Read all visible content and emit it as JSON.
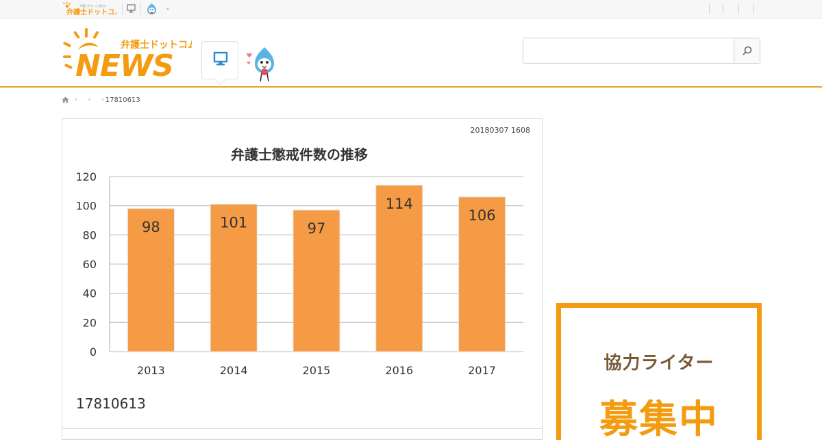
{
  "topbar": {
    "mini_logo_tagline": "弁護士をもっと身近に",
    "mini_logo_text": "弁護士ドットコム",
    "separator_text": "-"
  },
  "header": {
    "logo_top_text": "弁護士ドットコム",
    "logo_main_text": "NEWS",
    "search": {
      "placeholder": "",
      "value": ""
    }
  },
  "breadcrumb": {
    "current": "17810613"
  },
  "article": {
    "date": "20180307 1608",
    "caption": "17810613"
  },
  "chart_data": {
    "type": "bar",
    "title": "弁護士懲戒件数の推移",
    "categories": [
      "2013",
      "2014",
      "2015",
      "2016",
      "2017"
    ],
    "values": [
      98,
      101,
      97,
      114,
      106
    ],
    "ylim": [
      0,
      120
    ],
    "yticks": [
      "0",
      "20",
      "40",
      "60",
      "80",
      "100",
      "120"
    ],
    "grid": true,
    "bar_color": "#f59a45"
  },
  "sidebar": {
    "banner_line1": "協力ライター",
    "banner_line2": "募集中"
  },
  "colors": {
    "accent": "#e8a220",
    "banner_border": "#f39c12",
    "logo_orange": "#f39c12"
  }
}
